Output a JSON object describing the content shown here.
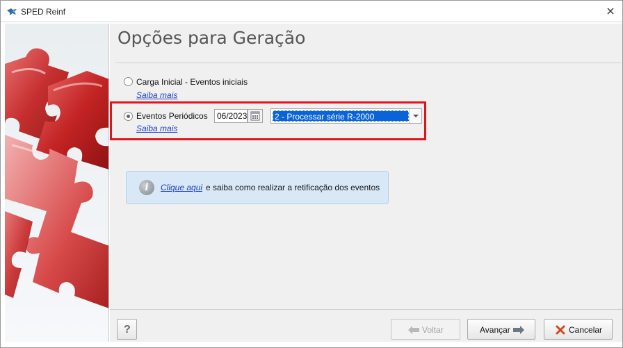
{
  "window": {
    "title": "SPED Reinf",
    "close_icon": "close-icon",
    "app_icon": "sped-logo-icon"
  },
  "page": {
    "title": "Opções para Geração"
  },
  "options": {
    "initial": {
      "label": "Carga Inicial - Eventos iniciais",
      "link": "Saiba mais",
      "selected": false
    },
    "periodic": {
      "label": "Eventos Periódicos",
      "link": "Saiba mais",
      "selected": true,
      "date": "06/2023",
      "calendar_icon": "calendar-icon",
      "select_value": "2 - Processar série R-2000"
    }
  },
  "info": {
    "icon": "info-icon",
    "link": "Clique aqui ",
    "text": "e saiba como realizar a retificação dos eventos"
  },
  "footer": {
    "help_label": "?",
    "back_label": "Voltar",
    "next_label": "Avançar",
    "cancel_label": "Cancelar"
  },
  "colors": {
    "highlight": "#e1141c",
    "selection": "#0a64d8",
    "link": "#1a3fc4",
    "info_bg": "#d8e8f6"
  }
}
